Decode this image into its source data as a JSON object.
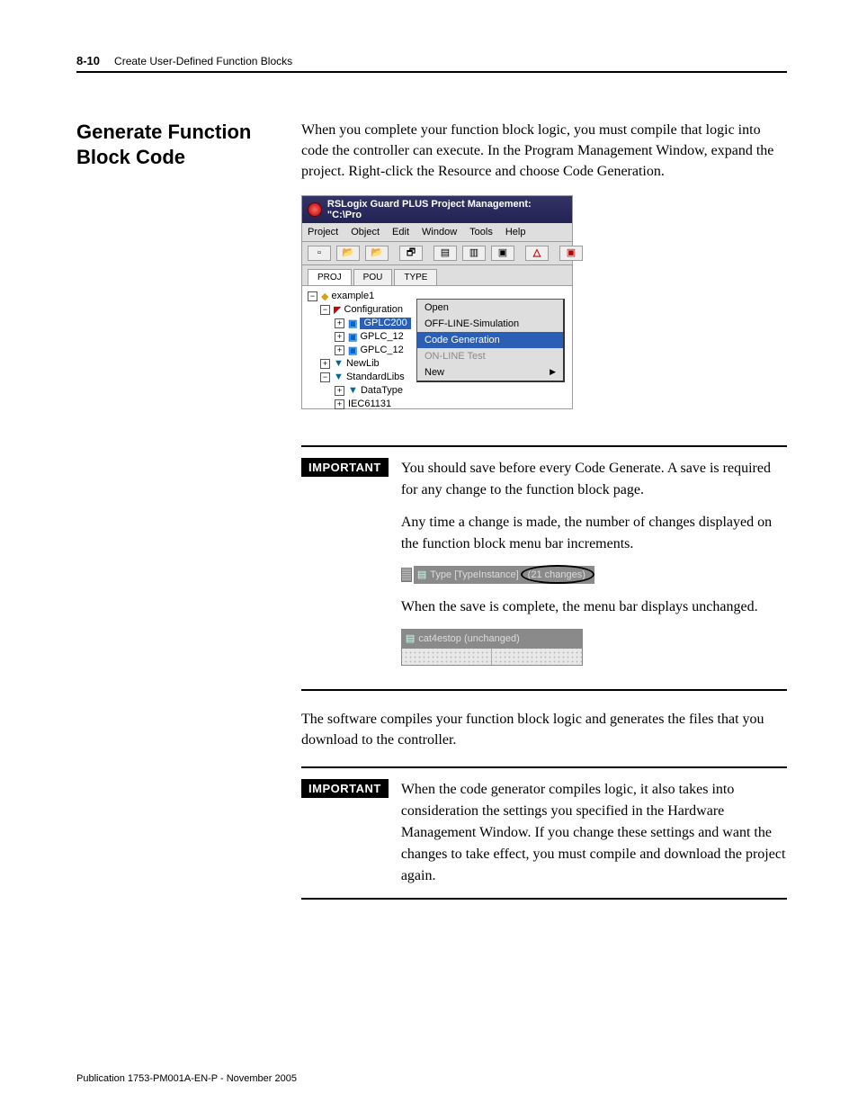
{
  "header": {
    "page_number": "8-10",
    "chapter_title": "Create User-Defined Function Blocks"
  },
  "section": {
    "heading": "Generate Function Block Code",
    "intro": "When you complete your function block logic, you must compile that logic into code the controller can execute. In the Program Management Window, expand the project. Right-click the Resource and choose Code Generation."
  },
  "screenshot1": {
    "title": "RSLogix Guard PLUS Project Management: \"C:\\Pro",
    "menus": [
      "Project",
      "Object",
      "Edit",
      "Window",
      "Tools",
      "Help"
    ],
    "tabs": {
      "proj": "PROJ",
      "pou": "POU",
      "type": "TYPE"
    },
    "tree": {
      "root": "example1",
      "config": "Configuration",
      "gplc200": "GPLC200",
      "gplc12a": "GPLC_12",
      "gplc12b": "GPLC_12",
      "newlib": "NewLib",
      "stdlibs": "StandardLibs",
      "datatype": "DataType",
      "iec": "IEC61131"
    },
    "context_menu": {
      "open": "Open",
      "offline": "OFF-LINE-Simulation",
      "codegen": "Code Generation",
      "online": "ON-LINE Test",
      "new": "New"
    }
  },
  "important1": {
    "label": "IMPORTANT",
    "p1": "You should save before every Code Generate. A save is required for any change to the function block page.",
    "p2": "Any time a change is made, the number of changes displayed on the function block menu bar increments.",
    "changes_bar": {
      "prefix": "Type [TypeInstance]",
      "changes": "(21 changes)"
    },
    "p3": "When the save is complete, the menu bar displays unchanged.",
    "unchanged_bar": "cat4estop (unchanged)"
  },
  "mid_paragraph": "The software compiles your function block logic and generates the files that you download to the controller.",
  "important2": {
    "label": "IMPORTANT",
    "text": "When the code generator compiles logic, it also takes into consideration the settings you specified in the Hardware Management Window. If you change these settings and want the changes to take effect, you must compile and download the project again."
  },
  "footer": "Publication 1753-PM001A-EN-P - November 2005"
}
